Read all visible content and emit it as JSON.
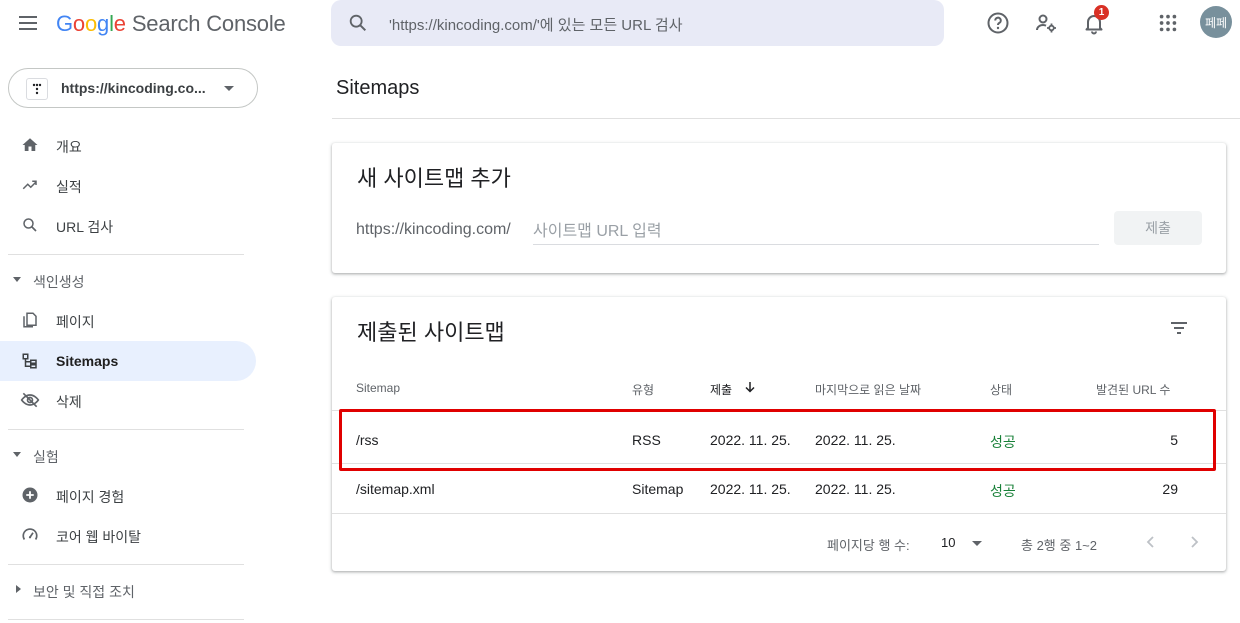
{
  "header": {
    "logo_google": [
      "G",
      "o",
      "o",
      "g",
      "l",
      "e"
    ],
    "logo_product": "Search Console",
    "search_placeholder": "'https://kincoding.com/'에 있는 모든 URL 검사",
    "notification_count": "1",
    "avatar_text": "페페"
  },
  "sidebar": {
    "property": "https://kincoding.co...",
    "items_top": [
      {
        "label": "개요",
        "icon": "home-icon"
      },
      {
        "label": "실적",
        "icon": "trending-up-icon"
      },
      {
        "label": "URL 검사",
        "icon": "search-icon"
      }
    ],
    "section_index": {
      "label": "색인생성",
      "items": [
        {
          "label": "페이지",
          "icon": "pages-icon"
        },
        {
          "label": "Sitemaps",
          "icon": "sitemap-icon",
          "active": true
        },
        {
          "label": "삭제",
          "icon": "visibility-off-icon"
        }
      ]
    },
    "section_experience": {
      "label": "실험",
      "items": [
        {
          "label": "페이지 경험",
          "icon": "add-circle-icon"
        },
        {
          "label": "코어 웹 바이탈",
          "icon": "speed-icon"
        }
      ]
    },
    "section_security": {
      "label": "보안 및 직접 조치"
    }
  },
  "main": {
    "page_title": "Sitemaps",
    "add_card": {
      "title": "새 사이트맵 추가",
      "url_prefix": "https://kincoding.com/",
      "input_placeholder": "사이트맵 URL 입력",
      "submit_label": "제출"
    },
    "submitted_card": {
      "title": "제출된 사이트맵",
      "columns": {
        "sitemap": "Sitemap",
        "type": "유형",
        "submitted": "제출",
        "last_read": "마지막으로 읽은 날짜",
        "status": "상태",
        "discovered": "발견된 URL 수"
      },
      "rows": [
        {
          "sitemap": "/rss",
          "type": "RSS",
          "submitted": "2022. 11. 25.",
          "last_read": "2022. 11. 25.",
          "status": "성공",
          "discovered": "5"
        },
        {
          "sitemap": "/sitemap.xml",
          "type": "Sitemap",
          "submitted": "2022. 11. 25.",
          "last_read": "2022. 11. 25.",
          "status": "성공",
          "discovered": "29"
        }
      ],
      "footer": {
        "rows_per_page_label": "페이지당 행 수:",
        "rows_per_page_value": "10",
        "range_label": "총 2행 중 1~2"
      }
    }
  },
  "colors": {
    "accent_bg": "#e8f0fe",
    "success": "#188038",
    "highlight": "#e00000",
    "badge": "#d93025"
  }
}
